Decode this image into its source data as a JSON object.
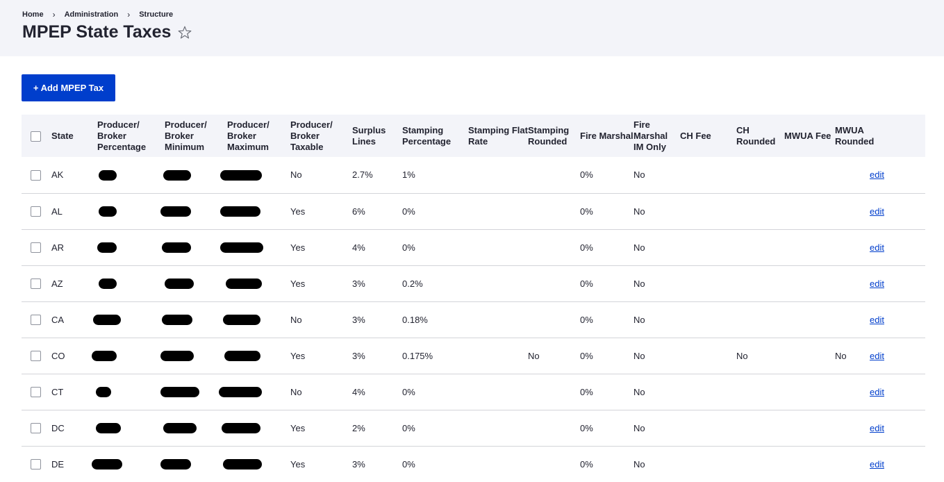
{
  "breadcrumb": [
    "Home",
    "Administration",
    "Structure"
  ],
  "breadcrumb_separator": "›",
  "page_title": "MPEP State Taxes",
  "add_button_label": "+ Add MPEP Tax",
  "columns": [
    "State",
    "Producer/ Broker Percentage",
    "Producer/ Broker Minimum",
    "Producer/ Broker Maximum",
    "Producer/ Broker Taxable",
    "Surplus Lines",
    "Stamping Percentage",
    "Stamping Flat Rate",
    "Stamping Rounded",
    "Fire Marshal",
    "Fire Marshal IM Only",
    "CH Fee",
    "CH Rounded",
    "MWUA Fee",
    "MWUA Rounded"
  ],
  "edit_label": "edit",
  "rows": [
    {
      "state": "AK",
      "taxable": "No",
      "surplus": "2.7%",
      "stamp_pct": "1%",
      "stamp_flat": "",
      "stamp_rounded": "",
      "fire": "0%",
      "fire_im": "No",
      "ch_fee": "",
      "ch_rounded": "",
      "mwua_fee": "",
      "mwua_rounded": ""
    },
    {
      "state": "AL",
      "taxable": "Yes",
      "surplus": "6%",
      "stamp_pct": "0%",
      "stamp_flat": "",
      "stamp_rounded": "",
      "fire": "0%",
      "fire_im": "No",
      "ch_fee": "",
      "ch_rounded": "",
      "mwua_fee": "",
      "mwua_rounded": ""
    },
    {
      "state": "AR",
      "taxable": "Yes",
      "surplus": "4%",
      "stamp_pct": "0%",
      "stamp_flat": "",
      "stamp_rounded": "",
      "fire": "0%",
      "fire_im": "No",
      "ch_fee": "",
      "ch_rounded": "",
      "mwua_fee": "",
      "mwua_rounded": ""
    },
    {
      "state": "AZ",
      "taxable": "Yes",
      "surplus": "3%",
      "stamp_pct": "0.2%",
      "stamp_flat": "",
      "stamp_rounded": "",
      "fire": "0%",
      "fire_im": "No",
      "ch_fee": "",
      "ch_rounded": "",
      "mwua_fee": "",
      "mwua_rounded": ""
    },
    {
      "state": "CA",
      "taxable": "No",
      "surplus": "3%",
      "stamp_pct": "0.18%",
      "stamp_flat": "",
      "stamp_rounded": "",
      "fire": "0%",
      "fire_im": "No",
      "ch_fee": "",
      "ch_rounded": "",
      "mwua_fee": "",
      "mwua_rounded": ""
    },
    {
      "state": "CO",
      "taxable": "Yes",
      "surplus": "3%",
      "stamp_pct": "0.175%",
      "stamp_flat": "",
      "stamp_rounded": "No",
      "fire": "0%",
      "fire_im": "No",
      "ch_fee": "",
      "ch_rounded": "No",
      "mwua_fee": "",
      "mwua_rounded": "No"
    },
    {
      "state": "CT",
      "taxable": "No",
      "surplus": "4%",
      "stamp_pct": "0%",
      "stamp_flat": "",
      "stamp_rounded": "",
      "fire": "0%",
      "fire_im": "No",
      "ch_fee": "",
      "ch_rounded": "",
      "mwua_fee": "",
      "mwua_rounded": ""
    },
    {
      "state": "DC",
      "taxable": "Yes",
      "surplus": "2%",
      "stamp_pct": "0%",
      "stamp_flat": "",
      "stamp_rounded": "",
      "fire": "0%",
      "fire_im": "No",
      "ch_fee": "",
      "ch_rounded": "",
      "mwua_fee": "",
      "mwua_rounded": ""
    },
    {
      "state": "DE",
      "taxable": "Yes",
      "surplus": "3%",
      "stamp_pct": "0%",
      "stamp_flat": "",
      "stamp_rounded": "",
      "fire": "0%",
      "fire_im": "No",
      "ch_fee": "",
      "ch_rounded": "",
      "mwua_fee": "",
      "mwua_rounded": ""
    }
  ],
  "colors": {
    "accent": "#003ecc",
    "header_bg": "#f3f4f9",
    "redaction": "#000000"
  }
}
